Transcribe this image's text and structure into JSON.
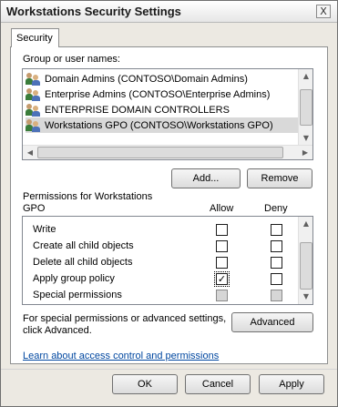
{
  "window": {
    "title": "Workstations Security Settings",
    "close_glyph": "X"
  },
  "tabs": [
    {
      "label": "Security"
    }
  ],
  "groups": {
    "label": "Group or user names:",
    "items": [
      {
        "name": "Domain Admins (CONTOSO\\Domain Admins)",
        "icon": "user-group-icon",
        "selected": false
      },
      {
        "name": "Enterprise Admins (CONTOSO\\Enterprise Admins)",
        "icon": "user-group-icon",
        "selected": false
      },
      {
        "name": "ENTERPRISE DOMAIN CONTROLLERS",
        "icon": "user-group-icon",
        "selected": false
      },
      {
        "name": "Workstations GPO (CONTOSO\\Workstations GPO)",
        "icon": "user-group-icon",
        "selected": true
      }
    ],
    "add_button": "Add...",
    "remove_button": "Remove"
  },
  "permissions": {
    "label_line1": "Permissions for Workstations",
    "label_line2": "GPO",
    "col_allow": "Allow",
    "col_deny": "Deny",
    "rows": [
      {
        "name": "Write",
        "allow": false,
        "deny": false,
        "disabled": false
      },
      {
        "name": "Create all child objects",
        "allow": false,
        "deny": false,
        "disabled": false
      },
      {
        "name": "Delete all child objects",
        "allow": false,
        "deny": false,
        "disabled": false
      },
      {
        "name": "Apply group policy",
        "allow": true,
        "deny": false,
        "disabled": false
      },
      {
        "name": "Special permissions",
        "allow": false,
        "deny": false,
        "disabled": true
      }
    ]
  },
  "advanced": {
    "text_line1": "For special permissions or advanced settings,",
    "text_line2": "click Advanced.",
    "button": "Advanced"
  },
  "learn_link": "Learn about access control and permissions",
  "footer": {
    "ok": "OK",
    "cancel": "Cancel",
    "apply": "Apply"
  },
  "scroll_glyphs": {
    "up": "▲",
    "down": "▼",
    "left": "◀",
    "right": "▶"
  },
  "check_glyph": "✓"
}
